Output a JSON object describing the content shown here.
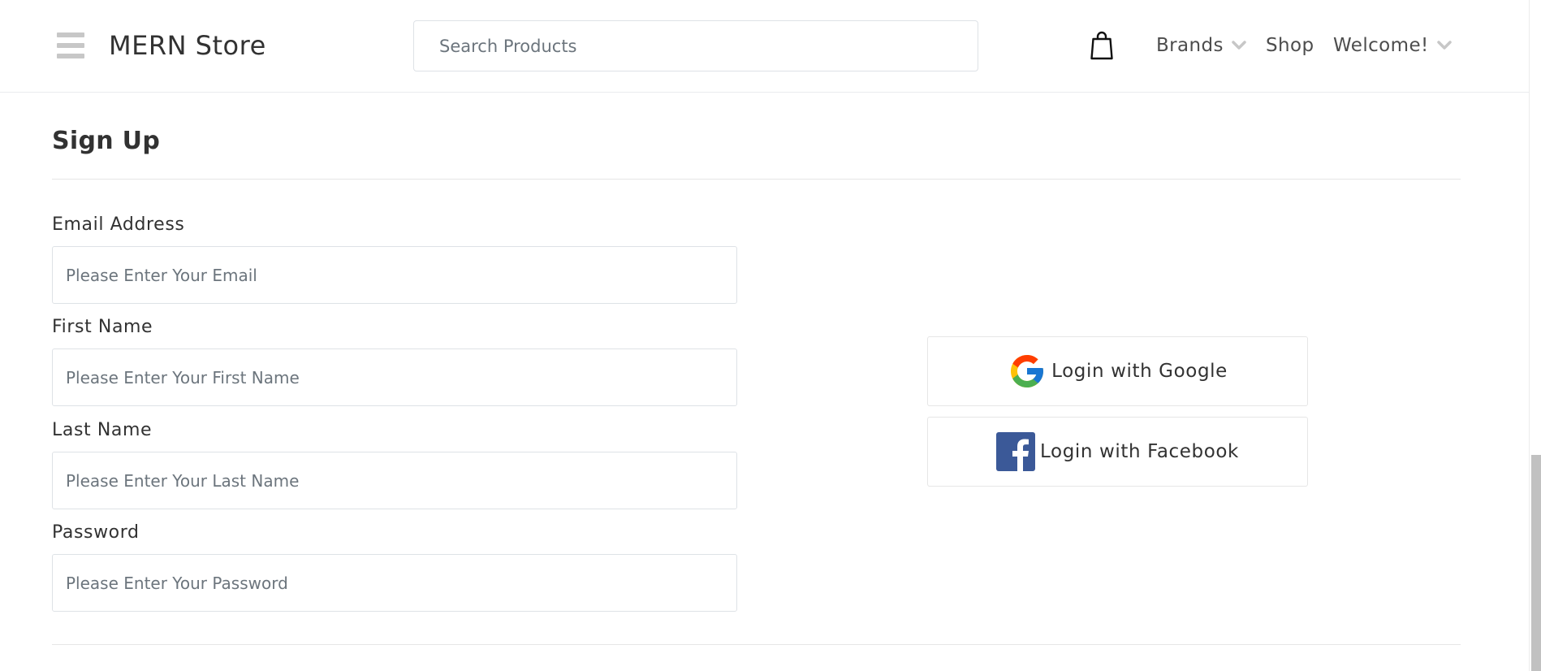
{
  "header": {
    "brand": "MERN Store",
    "search_placeholder": "Search Products",
    "nav": {
      "brands": "Brands",
      "shop": "Shop",
      "welcome": "Welcome!"
    },
    "icons": {
      "menu": "hamburger-menu-icon",
      "cart": "shopping-bag-icon",
      "dropdown": "chevron-down-icon"
    }
  },
  "signup": {
    "title": "Sign Up",
    "fields": {
      "email": {
        "label": "Email Address",
        "placeholder": "Please Enter Your Email",
        "value": ""
      },
      "first_name": {
        "label": "First Name",
        "placeholder": "Please Enter Your First Name",
        "value": ""
      },
      "last_name": {
        "label": "Last Name",
        "placeholder": "Please Enter Your Last Name",
        "value": ""
      },
      "password": {
        "label": "Password",
        "placeholder": "Please Enter Your Password",
        "value": ""
      }
    }
  },
  "social": {
    "google": {
      "label": "Login with Google",
      "icon": "google-icon"
    },
    "facebook": {
      "label": "Login with Facebook",
      "icon": "facebook-icon"
    }
  },
  "colors": {
    "text": "#323232",
    "border": "#dee2e6",
    "facebook_blue": "#3b5998",
    "icon_gray": "#c7c7c7"
  }
}
